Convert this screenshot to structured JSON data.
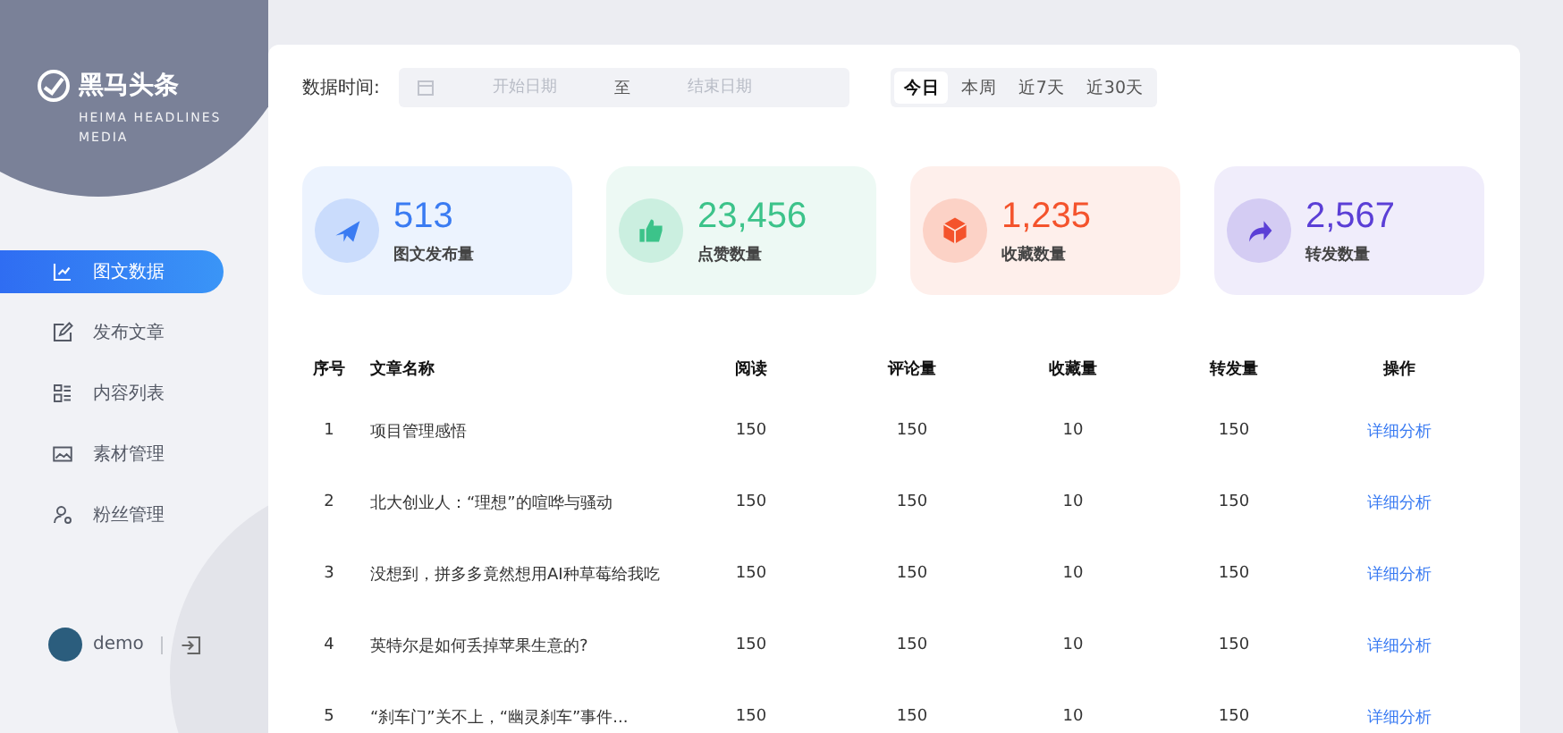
{
  "sidebar": {
    "logo": {
      "title": "黑马头条",
      "subtitle": "HEIMA HEADLINES MEDIA"
    },
    "menu": [
      {
        "label": "图文数据",
        "selected": true
      },
      {
        "label": "发布文章",
        "selected": false
      },
      {
        "label": "内容列表",
        "selected": false
      },
      {
        "label": "素材管理",
        "selected": false
      },
      {
        "label": "粉丝管理",
        "selected": false
      }
    ],
    "user": {
      "name": "demo"
    }
  },
  "filter": {
    "label": "数据时间:",
    "start_placeholder": "开始日期",
    "separator": "至",
    "end_placeholder": "结束日期",
    "ranges": [
      {
        "label": "今日",
        "selected": true
      },
      {
        "label": "本周",
        "selected": false
      },
      {
        "label": "近7天",
        "selected": false
      },
      {
        "label": "近30天",
        "selected": false
      }
    ]
  },
  "stats": [
    {
      "value": "513",
      "label": "图文发布量",
      "color": "#3a7bf2"
    },
    {
      "value": "23,456",
      "label": "点赞数量",
      "color": "#3cc38a"
    },
    {
      "value": "1,235",
      "label": "收藏数量",
      "color": "#f4532c"
    },
    {
      "value": "2,567",
      "label": "转发数量",
      "color": "#5b3fd6"
    }
  ],
  "table": {
    "columns": [
      "序号",
      "文章名称",
      "阅读",
      "评论量",
      "收藏量",
      "转发量",
      "操作"
    ],
    "rows": [
      {
        "cells": [
          "1",
          "项目管理感悟",
          "150",
          "150",
          "10",
          "150"
        ],
        "action": "详细分析"
      },
      {
        "cells": [
          "2",
          "北大创业人：“理想”的喧哗与骚动",
          "150",
          "150",
          "10",
          "150"
        ],
        "action": "详细分析"
      },
      {
        "cells": [
          "3",
          "没想到，拼多多竟然想用AI种草莓给我吃",
          "150",
          "150",
          "10",
          "150"
        ],
        "action": "详细分析"
      },
      {
        "cells": [
          "4",
          "英特尔是如何丢掉苹果生意的?",
          "150",
          "150",
          "10",
          "150"
        ],
        "action": "详细分析"
      },
      {
        "cells": [
          "5",
          "“刹车门”关不上，“幽灵刹车”事件...",
          "150",
          "150",
          "10",
          "150"
        ],
        "action": "详细分析"
      }
    ]
  }
}
